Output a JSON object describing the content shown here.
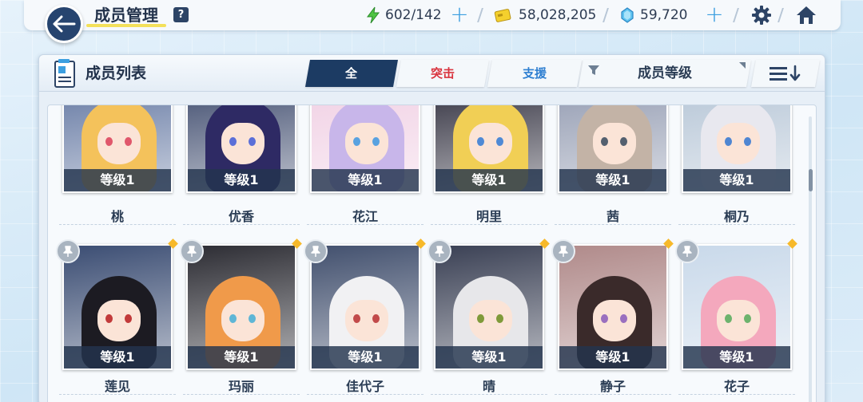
{
  "header": {
    "title": "成员管理",
    "help_label": "?",
    "stamina": "602/142",
    "credits": "58,028,205",
    "pyroxene": "59,720",
    "plus_label": "+"
  },
  "panel": {
    "title": "成员列表",
    "tabs": [
      {
        "label": "全",
        "active": true
      },
      {
        "label": "突击",
        "active": false
      },
      {
        "label": "支援",
        "active": false
      }
    ],
    "sort_label": "成员等级"
  },
  "rows": [
    {
      "cards": [
        {
          "name": "桃",
          "level": "等级1",
          "hair": "#f4c25b",
          "eyes": "#e0576b",
          "bg": "#6c7fa7"
        },
        {
          "name": "优香",
          "level": "等级1",
          "hair": "#2e2a64",
          "eyes": "#5b6fd8",
          "bg": "#4a5676"
        },
        {
          "name": "花江",
          "level": "等级1",
          "hair": "#c8b6ea",
          "eyes": "#59a2e0",
          "bg": "#f1d2e5"
        },
        {
          "name": "明里",
          "level": "等级1",
          "hair": "#f1cf55",
          "eyes": "#4f8ad5",
          "bg": "#3b3a48"
        },
        {
          "name": "茜",
          "level": "等级1",
          "hair": "#c3b3a6",
          "eyes": "#54606f",
          "bg": "#98a0b5"
        },
        {
          "name": "桐乃",
          "level": "等级1",
          "hair": "#e8e8ef",
          "eyes": "#4f86d2",
          "bg": "#b9c8d8"
        }
      ]
    },
    {
      "cards": [
        {
          "name": "莲见",
          "level": "等级1",
          "hair": "#1c1b22",
          "eyes": "#c23a3a",
          "bg": "#3b4d73"
        },
        {
          "name": "玛丽",
          "level": "等级1",
          "hair": "#f09a4a",
          "eyes": "#5fb6d6",
          "bg": "#2c2c33"
        },
        {
          "name": "佳代子",
          "level": "等级1",
          "hair": "#f1f1f3",
          "eyes": "#c24a4a",
          "bg": "#42506e"
        },
        {
          "name": "晴",
          "level": "等级1",
          "hair": "#e7e7ea",
          "eyes": "#7f9a3a",
          "bg": "#3a4054"
        },
        {
          "name": "静子",
          "level": "等级1",
          "hair": "#3a2a2a",
          "eyes": "#9a6fbf",
          "bg": "#b08a8a"
        },
        {
          "name": "花子",
          "level": "等级1",
          "hair": "#f4a8bd",
          "eyes": "#6db36d",
          "bg": "#c9d9ea"
        }
      ]
    }
  ],
  "colors": {
    "accent": "#1c3b63",
    "strike": "#d9343f",
    "support": "#2e7fd1",
    "plus": "#3c9fe0",
    "highlight": "#f3e05a"
  },
  "icons": {
    "back": "arrow-left-icon",
    "stamina": "lightning-icon",
    "credits": "credit-card-icon",
    "pyroxene": "crystal-icon",
    "settings": "gear-icon",
    "home": "home-icon",
    "list": "member-list-icon",
    "filter": "filter-icon",
    "order": "sort-descending-icon",
    "pin": "pin-icon"
  }
}
